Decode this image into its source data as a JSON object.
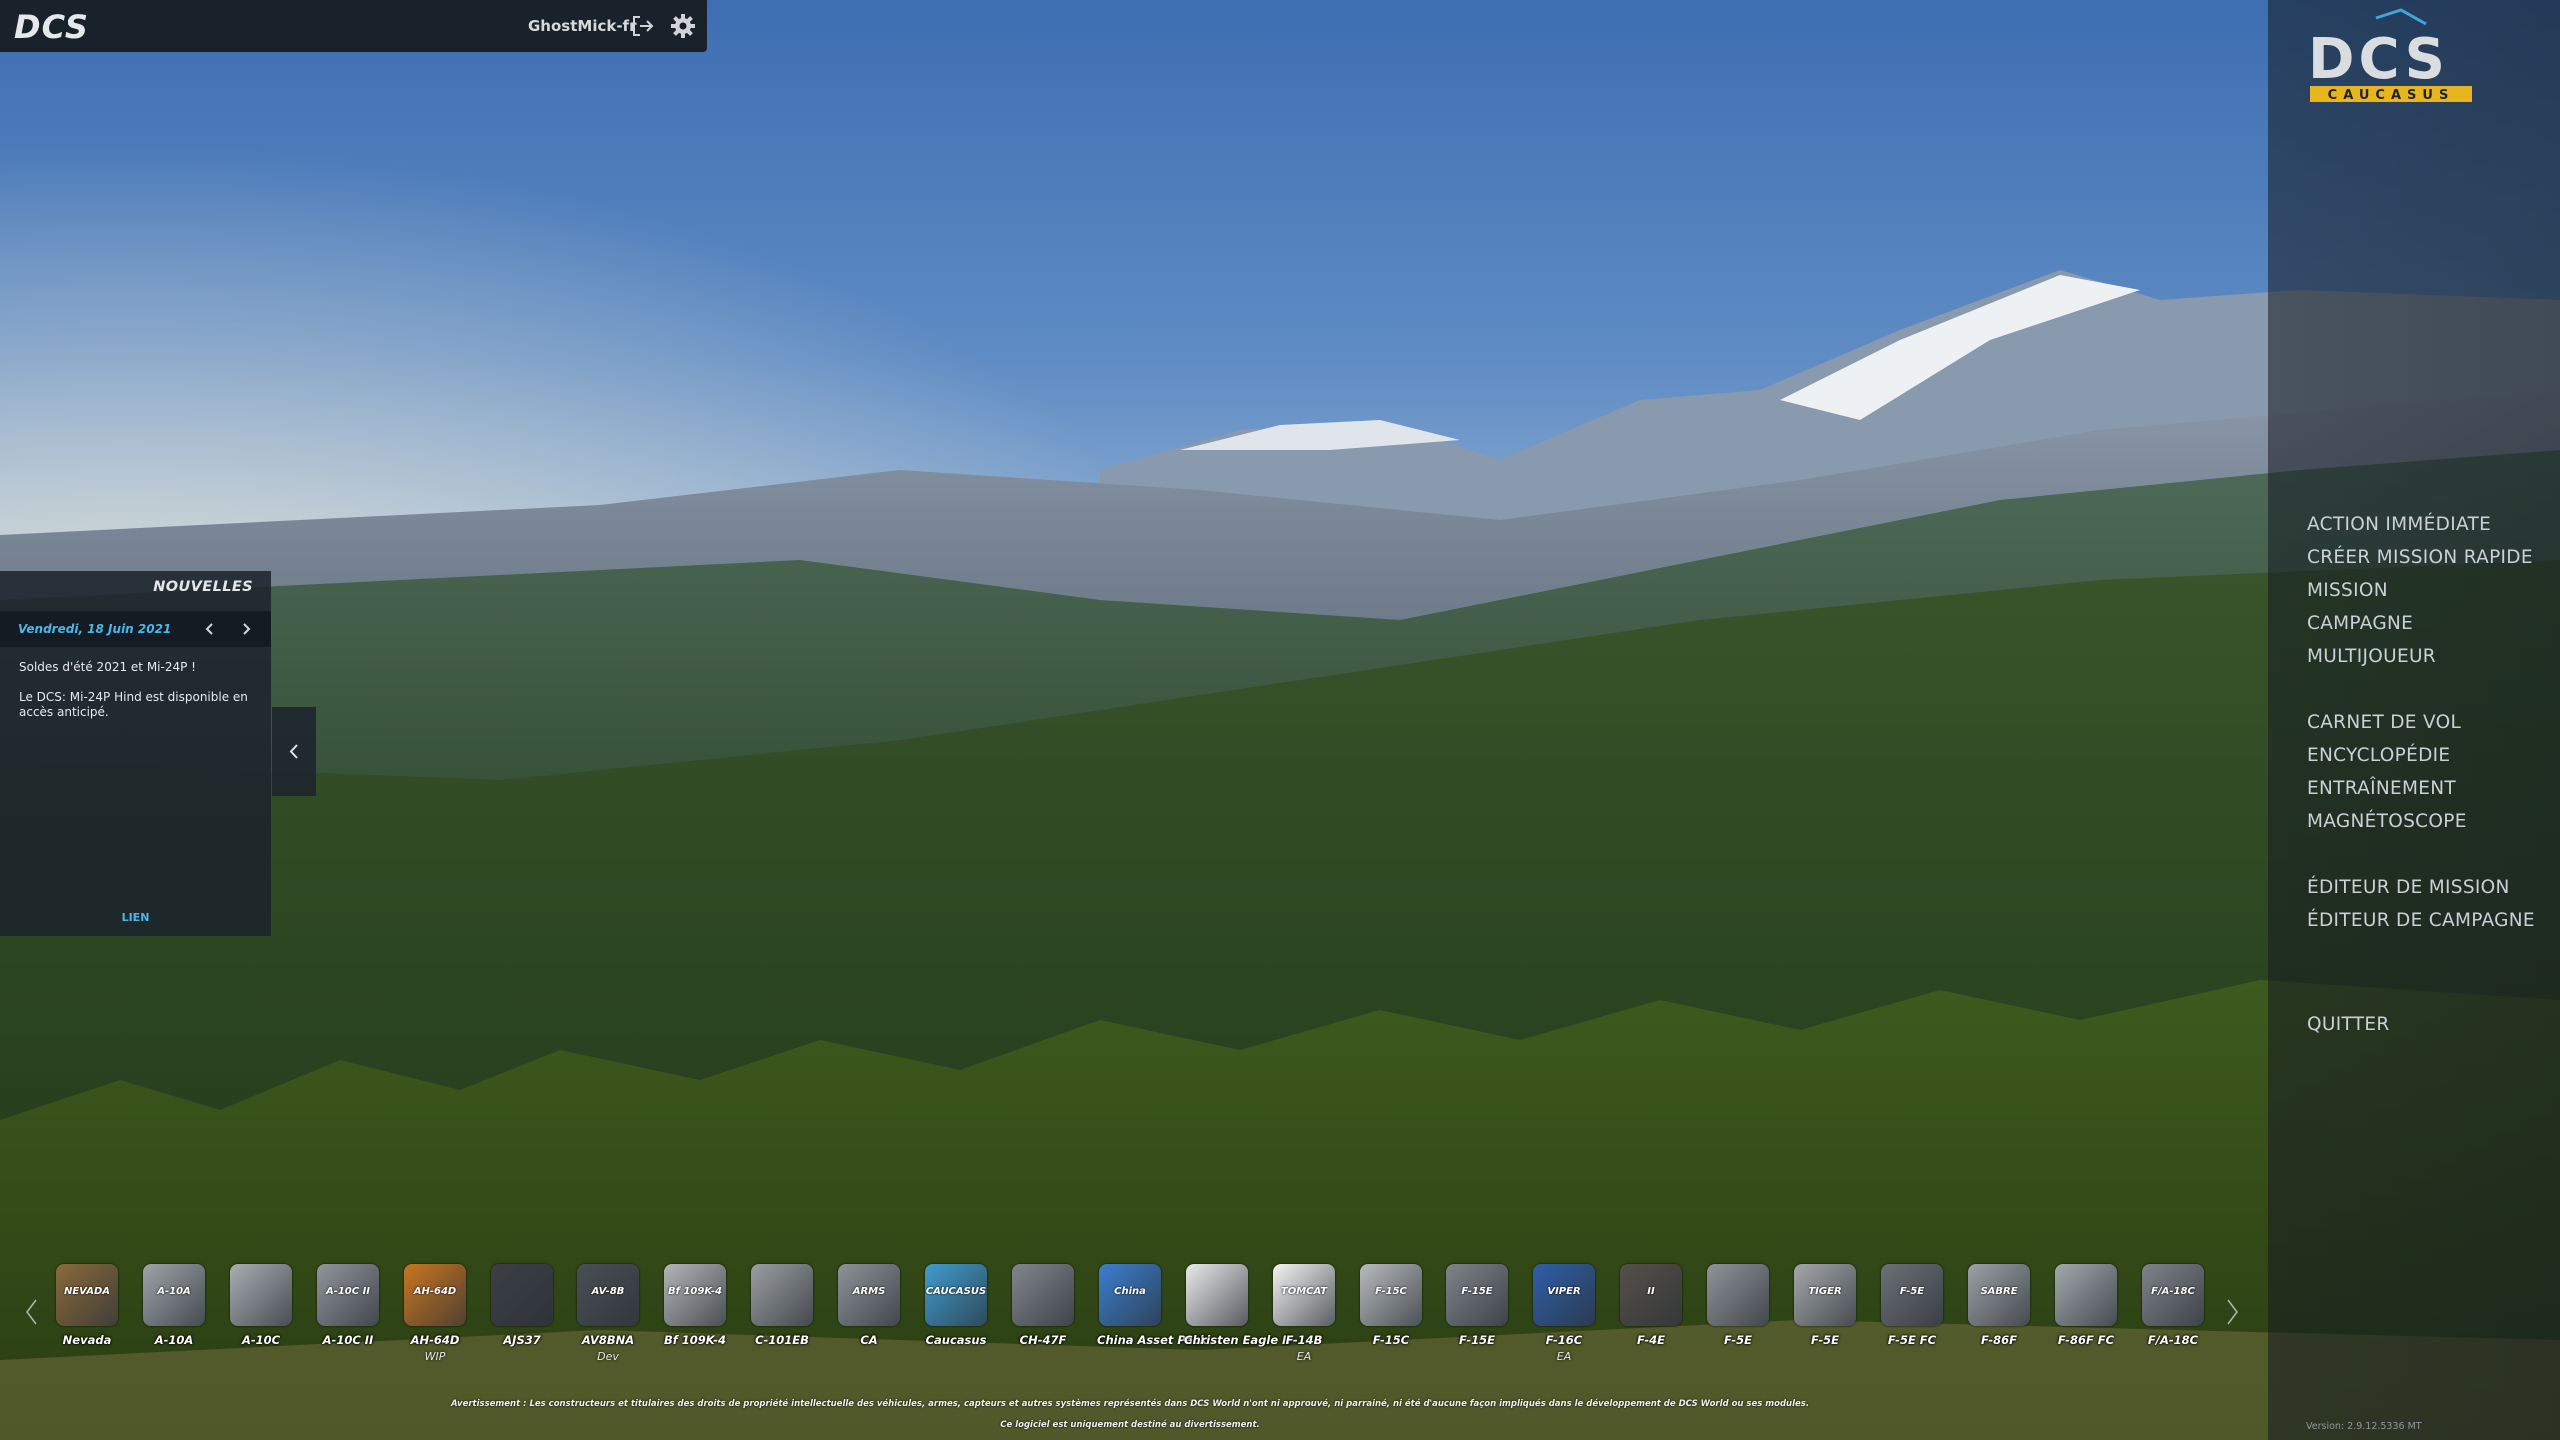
{
  "header": {
    "logo_text": "DCS",
    "username": "GhostMick-fr",
    "logout_icon": "logout-icon",
    "settings_icon": "gear-icon"
  },
  "module_logo": {
    "brand": "DCS",
    "subtitle": "CAUCASUS",
    "accent": "#e8b41f"
  },
  "menu": {
    "items": [
      "ACTION IMMÉDIATE",
      "CRÉER MISSION RAPIDE",
      "MISSION",
      "CAMPAGNE",
      "MULTIJOUEUR",
      "CARNET DE VOL",
      "ENCYCLOPÉDIE",
      "ENTRAÎNEMENT",
      "MAGNÉTOSCOPE",
      "ÉDITEUR DE MISSION",
      "ÉDITEUR DE CAMPAGNE",
      "QUITTER"
    ]
  },
  "news": {
    "title": "NOUVELLES",
    "date": "Vendredi, 18 Juin 2021",
    "headline": "Soldes d'été 2021 et Mi-24P !",
    "body": "Le DCS: Mi-24P Hind est disponible en accès anticipé.",
    "link": "LIEN"
  },
  "modules": [
    {
      "name": "Nevada",
      "status": "",
      "color": "#8a6a3a",
      "label": "NEVADA"
    },
    {
      "name": "A-10A",
      "status": "",
      "color": "#9ea4aa",
      "label": "A-10A"
    },
    {
      "name": "A-10C",
      "status": "",
      "color": "#a9aeb3",
      "label": ""
    },
    {
      "name": "A-10C II",
      "status": "",
      "color": "#8f959b",
      "label": "A-10C II"
    },
    {
      "name": "AH-64D",
      "status": "WIP",
      "color": "#c9761f",
      "label": "AH-64D"
    },
    {
      "name": "AJS37",
      "status": "",
      "color": "#3c4046",
      "label": ""
    },
    {
      "name": "AV8BNA",
      "status": "Dev",
      "color": "#4a4f55",
      "label": "AV-8B"
    },
    {
      "name": "Bf 109K-4",
      "status": "",
      "color": "#b3b6b8",
      "label": "Bf 109K-4"
    },
    {
      "name": "C-101EB",
      "status": "",
      "color": "#9a9ea2",
      "label": ""
    },
    {
      "name": "CA",
      "status": "",
      "color": "#8d9399",
      "label": "ARMS"
    },
    {
      "name": "Caucasus",
      "status": "",
      "color": "#3f9dd0",
      "label": "CAUCASUS"
    },
    {
      "name": "CH-47F",
      "status": "",
      "color": "#80868c",
      "label": ""
    },
    {
      "name": "China Asset Pack",
      "status": "",
      "color": "#3a7fd0",
      "label": "China"
    },
    {
      "name": "Christen Eagle II",
      "status": "",
      "color": "#e9eaeb",
      "label": ""
    },
    {
      "name": "F-14B",
      "status": "EA",
      "color": "#f4f4f4",
      "label": "TOMCAT"
    },
    {
      "name": "F-15C",
      "status": "",
      "color": "#b7bbbf",
      "label": "F-15C"
    },
    {
      "name": "F-15E",
      "status": "",
      "color": "#7e848a",
      "label": "F-15E"
    },
    {
      "name": "F-16C",
      "status": "EA",
      "color": "#2e5fa8",
      "label": "VIPER"
    },
    {
      "name": "F-4E",
      "status": "",
      "color": "#55504a",
      "label": "II"
    },
    {
      "name": "F-5E",
      "status": "",
      "color": "#8f9499",
      "label": ""
    },
    {
      "name": "F-5E",
      "status": "",
      "color": "#a4a8ac",
      "label": "TIGER"
    },
    {
      "name": "F-5E FC",
      "status": "",
      "color": "#6b7177",
      "label": "F-5E"
    },
    {
      "name": "F-86F",
      "status": "",
      "color": "#9ca1a6",
      "label": "SABRE"
    },
    {
      "name": "F-86F FC",
      "status": "",
      "color": "#a3a8ad",
      "label": ""
    },
    {
      "name": "F/A-18C",
      "status": "",
      "color": "#7d8388",
      "label": "F/A-18C"
    }
  ],
  "footer": {
    "disclaimer": "Avertissement : Les constructeurs et titulaires des droits de propriété intellectuelle des véhicules, armes, capteurs et autres systèmes représentés dans DCS World n'ont ni approuvé, ni parrainé, ni été d'aucune façon impliqués dans le développement de DCS World ou ses modules.",
    "notice": "Ce logiciel est uniquement destiné au divertissement.",
    "version": "Version: 2.9.12.5336 MT"
  },
  "colors": {
    "accent_blue": "#4db6e8",
    "panel_bg": "#1c232c",
    "menu_text": "#c9d0d6"
  }
}
